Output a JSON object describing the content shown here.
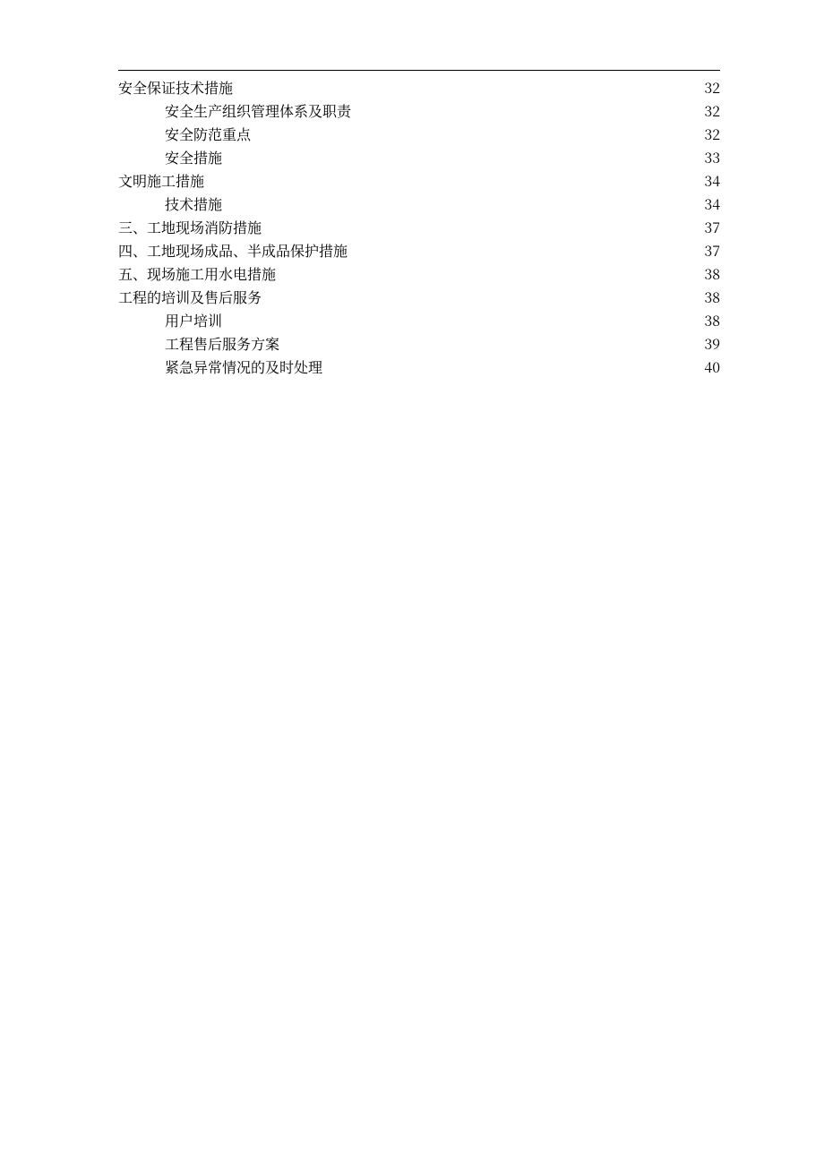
{
  "toc": {
    "entries": [
      {
        "level": 1,
        "title": "安全保证技术措施",
        "page": "32",
        "leader": "dense"
      },
      {
        "level": 2,
        "title": "安全生产组织管理体系及职责",
        "page": "32",
        "leader": "sparse"
      },
      {
        "level": 2,
        "title": "安全防范重点",
        "page": "32",
        "leader": "sparse"
      },
      {
        "level": 2,
        "title": "安全措施",
        "page": "33",
        "leader": "sparse"
      },
      {
        "level": 1,
        "title": "文明施工措施",
        "page": "34",
        "leader": "dense"
      },
      {
        "level": 2,
        "title": "技术措施",
        "page": "34",
        "leader": "sparse"
      },
      {
        "level": 1,
        "title": "三、工地现场消防措施",
        "page": "37",
        "leader": "dense"
      },
      {
        "level": 1,
        "title": "四、工地现场成品、半成品保护措施",
        "page": "37",
        "leader": "dense"
      },
      {
        "level": 1,
        "title": "五、现场施工用水电措施",
        "page": "38",
        "leader": "dense"
      },
      {
        "level": 1,
        "title": "工程的培训及售后服务",
        "page": "38",
        "leader": "dense"
      },
      {
        "level": 2,
        "title": "用户培训",
        "page": "38",
        "leader": "sparse"
      },
      {
        "level": 2,
        "title": "工程售后服务方案",
        "page": "39",
        "leader": "sparse"
      },
      {
        "level": 2,
        "title": "紧急异常情况的及时处理",
        "page": "40",
        "leader": "sparse"
      }
    ]
  }
}
